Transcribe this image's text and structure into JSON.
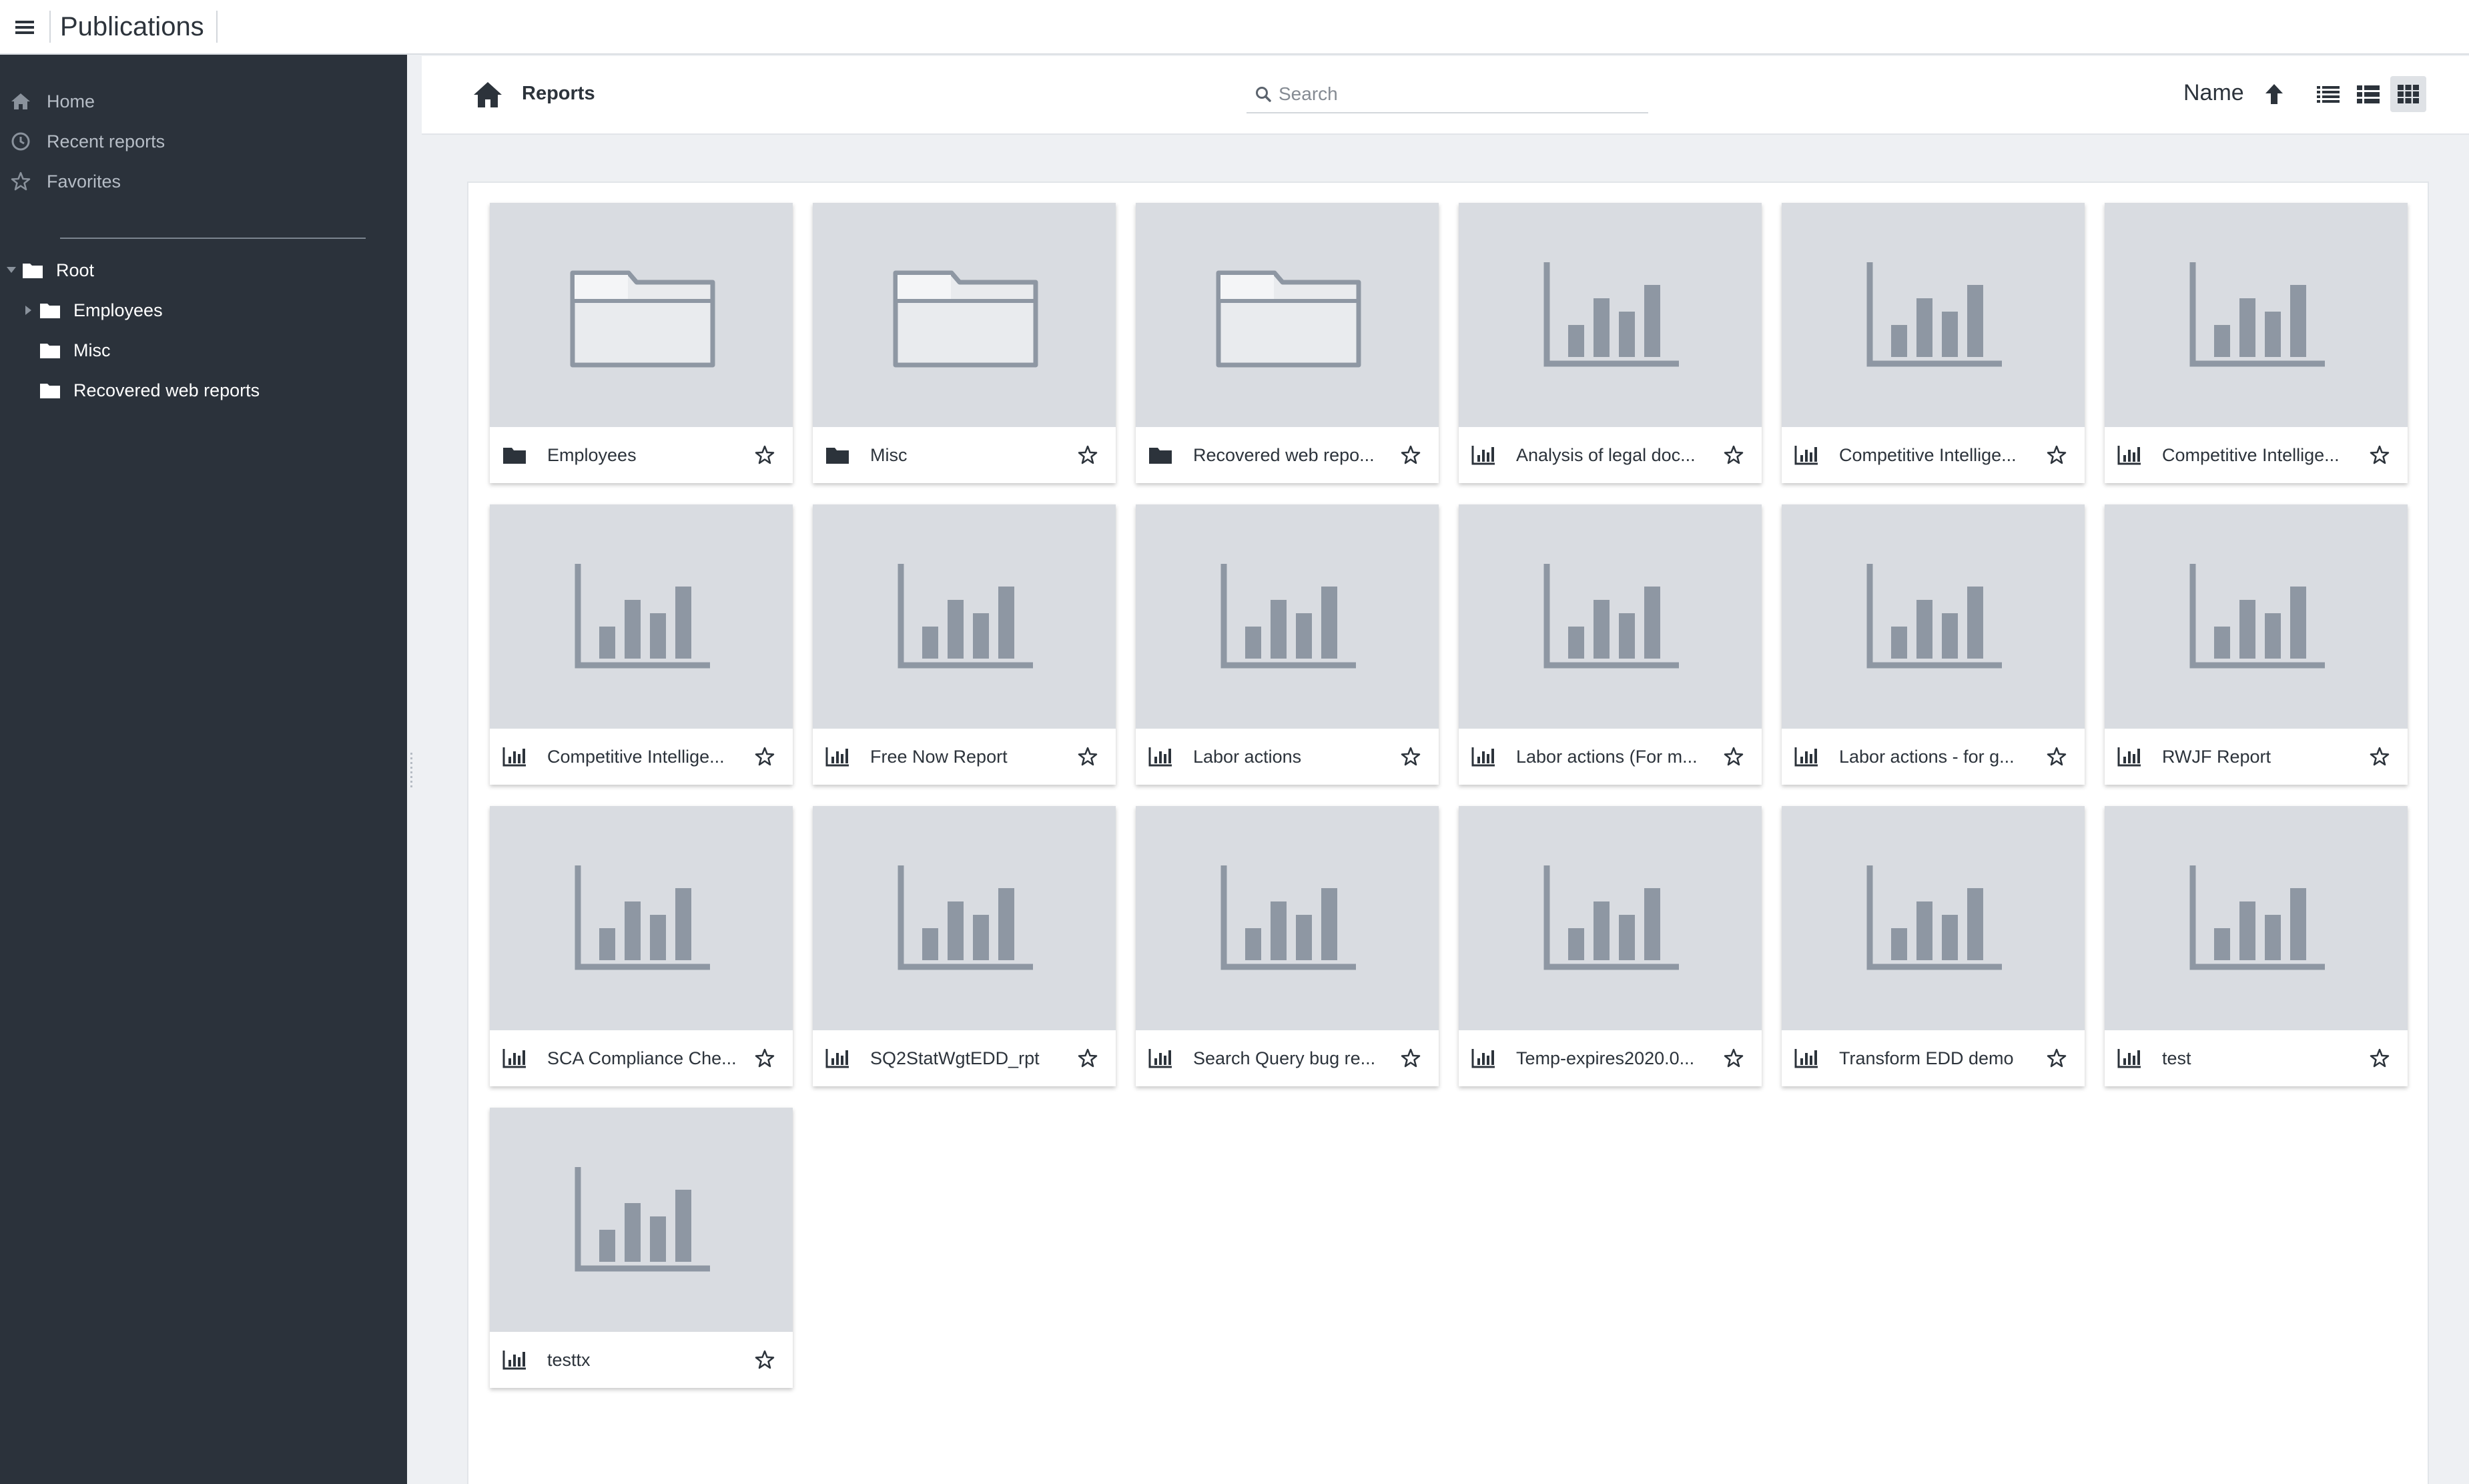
{
  "app": {
    "title": "Publications"
  },
  "sidebar": {
    "nav": [
      {
        "label": "Home",
        "icon": "home-icon"
      },
      {
        "label": "Recent reports",
        "icon": "clock-icon"
      },
      {
        "label": "Favorites",
        "icon": "star-icon"
      }
    ],
    "tree": [
      {
        "label": "Root",
        "icon": "folder-icon",
        "expanded": true
      },
      {
        "label": "Employees",
        "icon": "folder-icon",
        "collapsed": true
      },
      {
        "label": "Misc",
        "icon": "folder-icon"
      },
      {
        "label": "Recovered web reports",
        "icon": "folder-icon"
      }
    ]
  },
  "toolbar": {
    "breadcrumb": "Reports",
    "search_placeholder": "Search",
    "sort_label": "Name",
    "sort_direction": "ascending",
    "active_view": "grid"
  },
  "items": [
    {
      "type": "folder",
      "name": "Employees"
    },
    {
      "type": "folder",
      "name": "Misc"
    },
    {
      "type": "folder",
      "name": "Recovered web repo..."
    },
    {
      "type": "report",
      "name": "Analysis of legal doc..."
    },
    {
      "type": "report",
      "name": "Competitive Intellige..."
    },
    {
      "type": "report",
      "name": "Competitive Intellige..."
    },
    {
      "type": "report",
      "name": "Competitive Intellige..."
    },
    {
      "type": "report",
      "name": "Free Now Report"
    },
    {
      "type": "report",
      "name": "Labor actions"
    },
    {
      "type": "report",
      "name": "Labor actions (For m..."
    },
    {
      "type": "report",
      "name": "Labor actions - for g..."
    },
    {
      "type": "report",
      "name": "RWJF Report"
    },
    {
      "type": "report",
      "name": "SCA Compliance Che..."
    },
    {
      "type": "report",
      "name": "SQ2StatWgtEDD_rpt"
    },
    {
      "type": "report",
      "name": "Search Query bug re..."
    },
    {
      "type": "report",
      "name": "Temp-expires2020.0..."
    },
    {
      "type": "report",
      "name": "Transform EDD demo"
    },
    {
      "type": "report",
      "name": "test"
    },
    {
      "type": "report",
      "name": "testtx"
    }
  ],
  "colors": {
    "sidebar_bg": "#2b323b",
    "thumb_bg": "#d9dce1",
    "thumb_icon": "#8e97a3",
    "text": "#2c333b"
  }
}
